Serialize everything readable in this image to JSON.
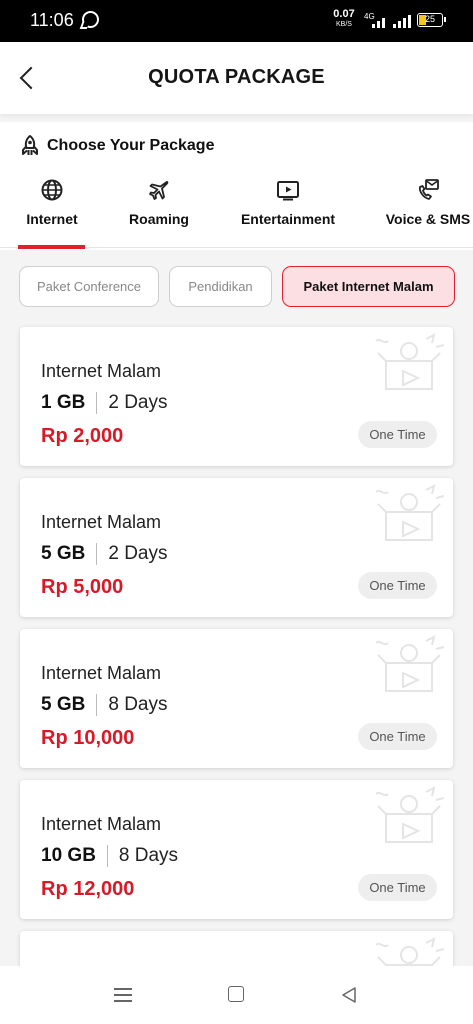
{
  "status_bar": {
    "time": "11:06",
    "net_speed_value": "0.07",
    "net_speed_unit": "KB/S",
    "network_type": "4G",
    "battery_level": "25",
    "icons": [
      "whatsapp-icon",
      "signal-icon",
      "battery-icon"
    ]
  },
  "header": {
    "title": "QUOTA PACKAGE",
    "back_icon": "back-arrow-icon"
  },
  "package_panel": {
    "choose_label": "Choose Your Package",
    "choose_icon": "rocket-icon",
    "categories": [
      {
        "label": "Internet",
        "icon": "globe-icon",
        "selected": true
      },
      {
        "label": "Roaming",
        "icon": "airplane-icon",
        "selected": false
      },
      {
        "label": "Entertainment",
        "icon": "play-icon",
        "selected": false
      },
      {
        "label": "Voice & SMS",
        "icon": "phone-message-icon",
        "selected": false
      }
    ]
  },
  "filters": [
    {
      "label": "Paket Conference",
      "selected": false
    },
    {
      "label": "Pendidikan",
      "selected": false
    },
    {
      "label": "Paket Internet Malam",
      "selected": true
    }
  ],
  "packages": [
    {
      "name": "Internet Malam",
      "quota": "1 GB",
      "duration": "2 Days",
      "price": "Rp 2,000",
      "badge": "One Time"
    },
    {
      "name": "Internet Malam",
      "quota": "5 GB",
      "duration": "2 Days",
      "price": "Rp 5,000",
      "badge": "One Time"
    },
    {
      "name": "Internet Malam",
      "quota": "5 GB",
      "duration": "8 Days",
      "price": "Rp 10,000",
      "badge": "One Time"
    },
    {
      "name": "Internet Malam",
      "quota": "10 GB",
      "duration": "8 Days",
      "price": "Rp 12,000",
      "badge": "One Time"
    }
  ],
  "colors": {
    "accent": "#e0202f",
    "price": "#d71a28",
    "selected_chip_bg": "#fcdfe2",
    "background": "#f4f4f4"
  },
  "nav_bar": {
    "icons": [
      "menu-icon",
      "home-icon",
      "back-icon"
    ]
  }
}
